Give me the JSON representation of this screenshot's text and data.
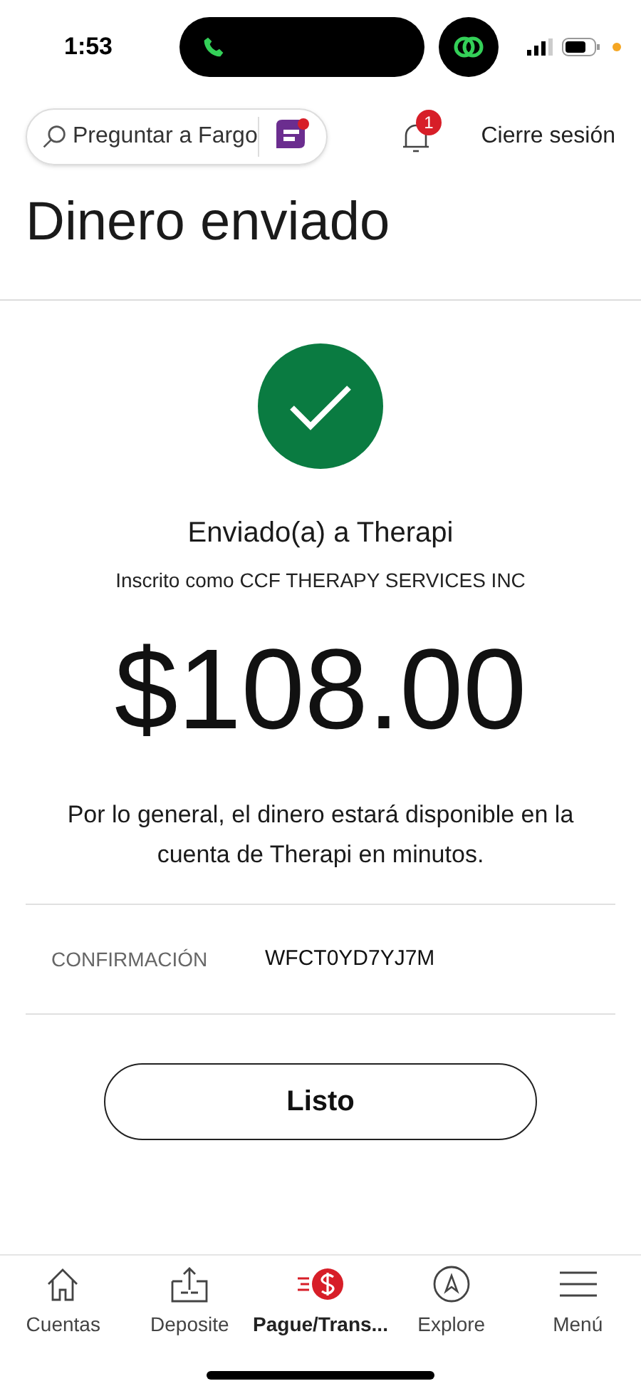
{
  "status_bar": {
    "time": "1:53"
  },
  "header": {
    "search": {
      "placeholder": "Preguntar a Fargo"
    },
    "notifications": {
      "count": "1"
    },
    "logout": "Cierre sesión"
  },
  "title": "Dinero enviado",
  "result": {
    "heading": "Enviado(a) a Therapi",
    "subheading": "Inscrito como CCF THERAPY SERVICES INC",
    "amount": "$108.00",
    "message": "Por lo general, el dinero estará disponible en la cuenta de Therapi en minutos."
  },
  "details": [
    {
      "label": "CONFIRMACIÓN",
      "value": "WFCT0YD7YJ7M"
    }
  ],
  "done_button": "Listo",
  "bottom_nav": [
    {
      "kind": "home",
      "label": "Cuentas",
      "selected": false
    },
    {
      "kind": "deposit",
      "label": "Deposite",
      "selected": false
    },
    {
      "kind": "pay",
      "label": "Pague/Trans...",
      "selected": true
    },
    {
      "kind": "explore",
      "label": "Explore",
      "selected": false
    },
    {
      "kind": "menu",
      "label": "Menú",
      "selected": false
    }
  ]
}
